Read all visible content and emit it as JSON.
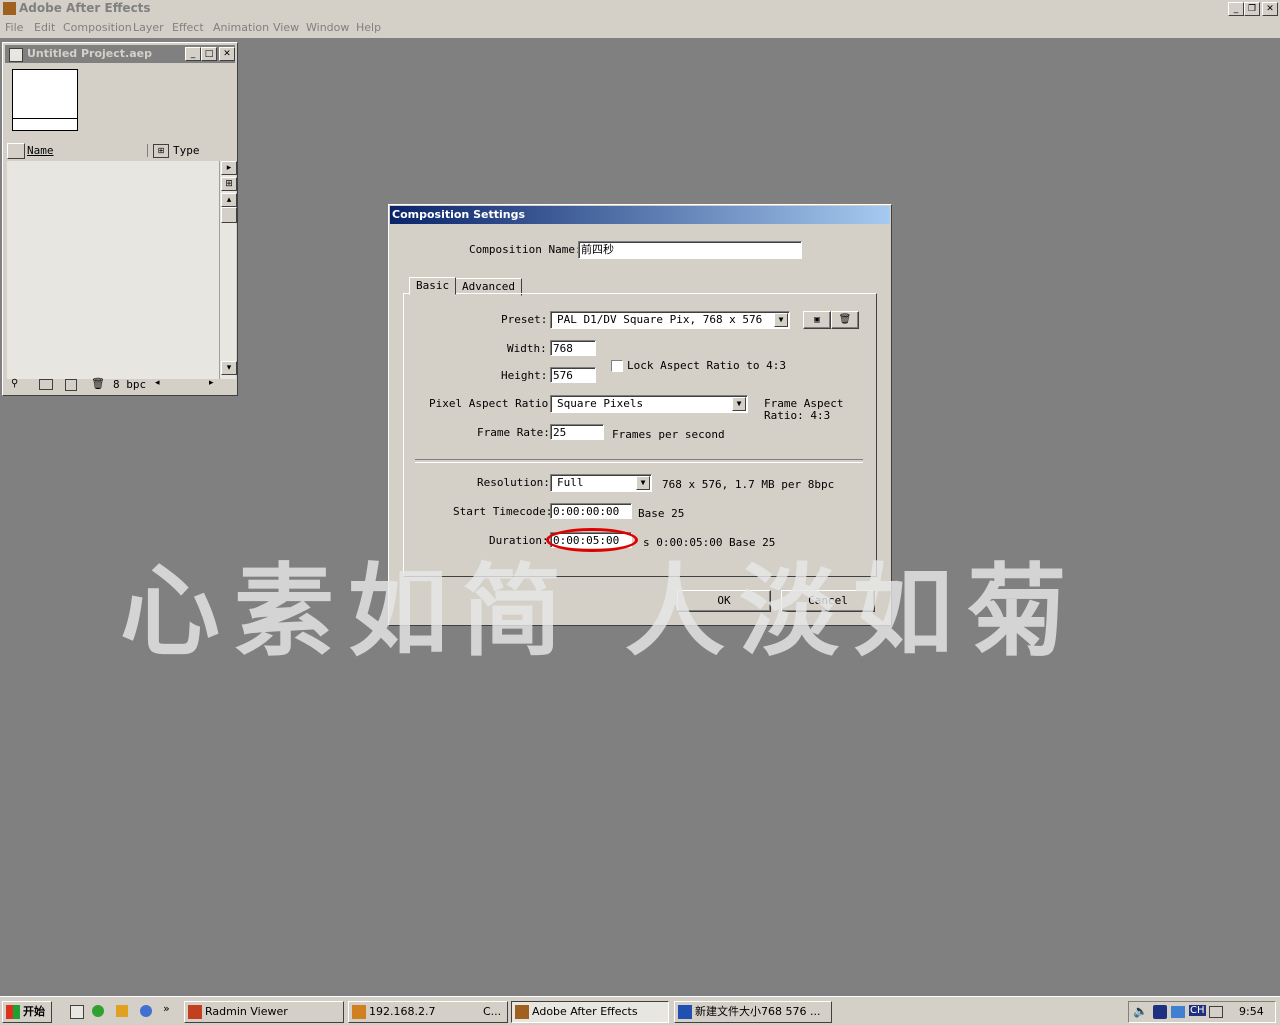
{
  "app": {
    "title": "Adobe After Effects",
    "menu": [
      "File",
      "Edit",
      "Composition",
      "Layer",
      "Effect",
      "Animation",
      "View",
      "Window",
      "Help"
    ]
  },
  "project": {
    "title": "Untitled Project.aep",
    "col_name": "Name",
    "col_type": "Type",
    "bpc": "8 bpc"
  },
  "dialog": {
    "title": "Composition Settings",
    "comp_name_label": "Composition Name:",
    "comp_name_value": "前四秒",
    "tabs": [
      "Basic",
      "Advanced"
    ],
    "preset_label": "Preset:",
    "preset_value": "PAL D1/DV Square Pix, 768 x 576",
    "width_label": "Width:",
    "width_value": "768",
    "height_label": "Height:",
    "height_value": "576",
    "lock_label": "Lock Aspect Ratio to 4:3",
    "lock_checked": false,
    "par_label": "Pixel Aspect Ratio:",
    "par_value": "Square Pixels",
    "frame_aspect_line1": "Frame Aspect",
    "frame_aspect_line2": "Ratio: 4:3",
    "fps_label": "Frame Rate:",
    "fps_value": "25",
    "fps_unit": "Frames per second",
    "res_label": "Resolution:",
    "res_value": "Full",
    "res_info": "768 x 576, 1.7 MB per 8bpc",
    "start_label": "Start Timecode:",
    "start_value": "0:00:00:00",
    "start_base": "Base 25",
    "dur_label": "Duration:",
    "dur_value": "0:00:05:00",
    "dur_info": "s 0:00:05:00",
    "dur_base": "Base 25",
    "ok_label": "OK",
    "cancel_label": "Cancel",
    "highlight_color": "#e00000"
  },
  "watermark": "心素如简 人淡如菊",
  "taskbar": {
    "start_label": "开始",
    "items": [
      {
        "label": "Radmin Viewer"
      },
      {
        "label": "192.168.2.7",
        "suffix": "C..."
      },
      {
        "label": "Adobe After Effects"
      },
      {
        "label": "新建文件大小768 576 ..."
      }
    ],
    "clock": "9:54",
    "lang": "CH"
  }
}
